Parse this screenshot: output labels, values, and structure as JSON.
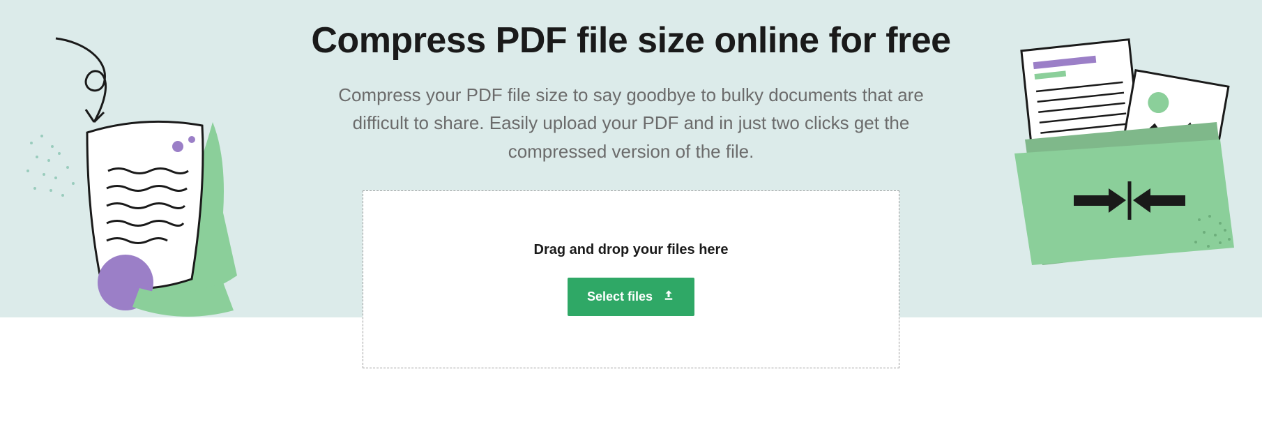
{
  "hero": {
    "title": "Compress PDF file size online for free",
    "description": "Compress your PDF file size to say goodbye to bulky documents that are difficult to share. Easily upload your PDF and in just two clicks get the compressed version of the file."
  },
  "dropzone": {
    "label": "Drag and drop your files here",
    "button_label": "Select files"
  }
}
